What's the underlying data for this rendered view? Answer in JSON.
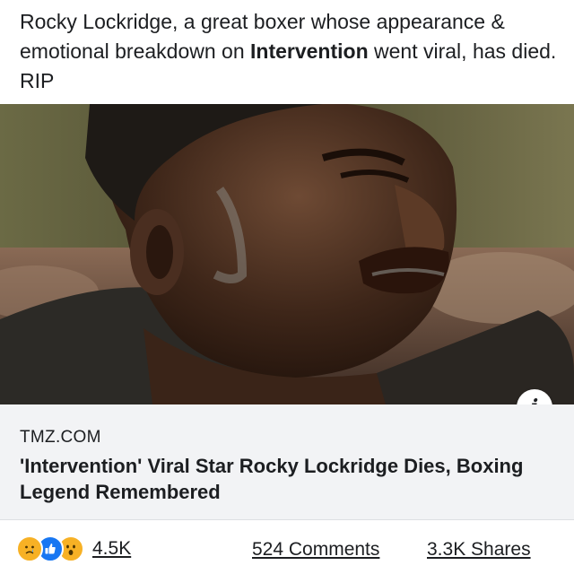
{
  "post": {
    "caption_part1": "Rocky Lockridge, a great boxer whose appearance & emotional breakdown on ",
    "caption_bold": "Intervention",
    "caption_part2": " went viral, has died. RIP"
  },
  "link": {
    "domain": "TMZ.COM",
    "title": "'Intervention' Viral Star Rocky Lockridge Dies, Boxing Legend Remembered",
    "info_glyph": "i"
  },
  "footer": {
    "reactions": [
      "sad-reaction-icon",
      "like-reaction-icon",
      "wow-reaction-icon"
    ],
    "reaction_count": "4.5K",
    "comments": "524 Comments",
    "shares": "3.3K Shares"
  },
  "colors": {
    "like_blue": "#1877f2",
    "emoji_yellow": "#f7b125",
    "preview_bg": "#f2f3f5",
    "text": "#1c1e21"
  }
}
